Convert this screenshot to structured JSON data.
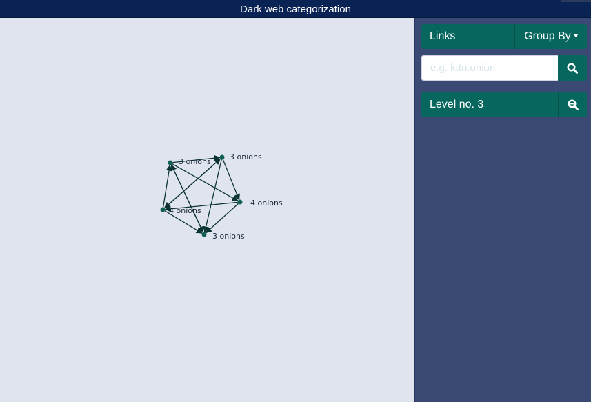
{
  "app": {
    "title": "Dark web categorization"
  },
  "sidebar": {
    "links_label": "Links",
    "group_by_label": "Group By",
    "search": {
      "placeholder": "e.g. kttn.onion",
      "value": ""
    },
    "level_label": "Level no. 3"
  },
  "graph": {
    "nodes": [
      {
        "id": "n1",
        "label": "3 onions"
      },
      {
        "id": "n2",
        "label": "3 onions"
      },
      {
        "id": "n3",
        "label": "4 onions"
      },
      {
        "id": "n4",
        "label": "4 onions"
      },
      {
        "id": "n5",
        "label": "3 onions"
      }
    ],
    "edges": [
      [
        "n1",
        "n2"
      ],
      [
        "n1",
        "n3"
      ],
      [
        "n1",
        "n5"
      ],
      [
        "n2",
        "n3"
      ],
      [
        "n2",
        "n4"
      ],
      [
        "n2",
        "n5"
      ],
      [
        "n3",
        "n4"
      ],
      [
        "n4",
        "n1"
      ],
      [
        "n4",
        "n5"
      ],
      [
        "n5",
        "n1"
      ],
      [
        "n3",
        "n5"
      ],
      [
        "n4",
        "n2"
      ]
    ]
  },
  "colors": {
    "header": "#0a2355",
    "sidebar": "#3b4a75",
    "accent": "#07665d",
    "canvas": "#e0e4ee"
  }
}
